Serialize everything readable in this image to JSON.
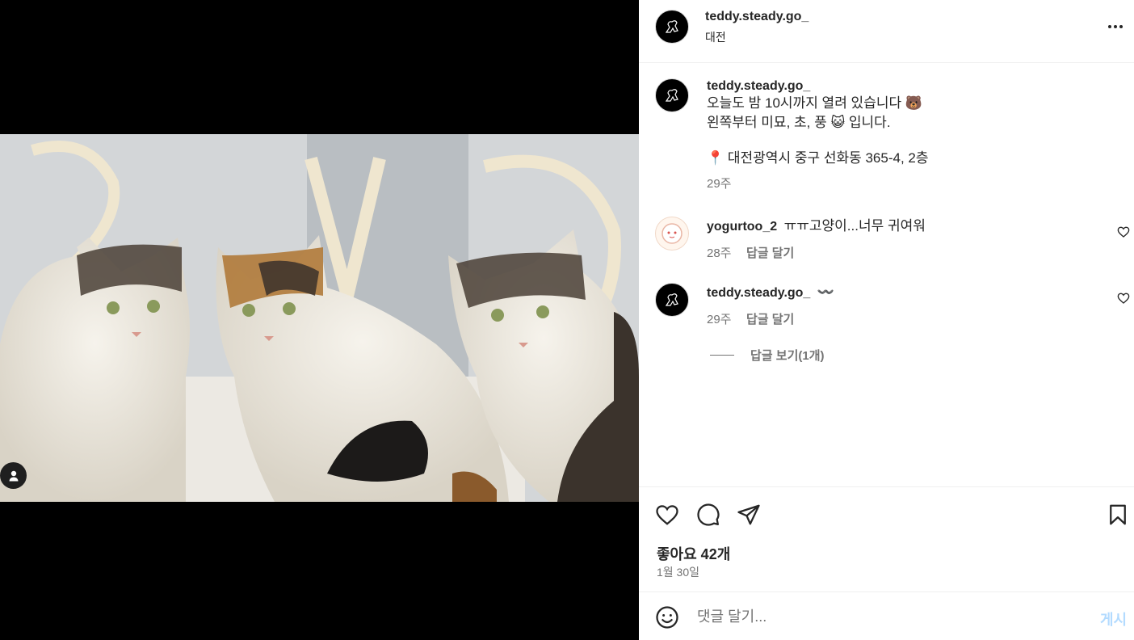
{
  "post": {
    "username": "teddy.steady.go_",
    "location": "대전",
    "caption_username": "teddy.steady.go_",
    "caption_line1": "오늘도 밤 10시까지 열려 있습니다 🐻",
    "caption_line2": "왼쪽부터 미묘, 초, 풍 😺 입니다.",
    "address": "📍 대전광역시 중구 선화동 365-4, 2층",
    "caption_age": "29주"
  },
  "comments": [
    {
      "username": "yogurtoo_2",
      "text": "ㅠㅠ고양이...너무 귀여워",
      "age": "28주",
      "reply_label": "답글 달기"
    },
    {
      "username": "teddy.steady.go_",
      "text": "〰️",
      "age": "29주",
      "reply_label": "답글 달기",
      "view_replies": "답글 보기(1개)"
    }
  ],
  "actions": {
    "likes": "좋아요 42개",
    "date": "1월 30일"
  },
  "composer": {
    "placeholder": "댓글 달기...",
    "post_label": "게시"
  },
  "icons": {
    "more": "more-icon",
    "like": "heart-icon",
    "comment": "comment-icon",
    "share": "send-icon",
    "save": "bookmark-icon",
    "emoji": "emoji-icon",
    "tag": "user-tag-icon"
  },
  "colors": {
    "accent": "#0095f6",
    "post_button_disabled": "#b3dbff",
    "muted": "#737373"
  }
}
